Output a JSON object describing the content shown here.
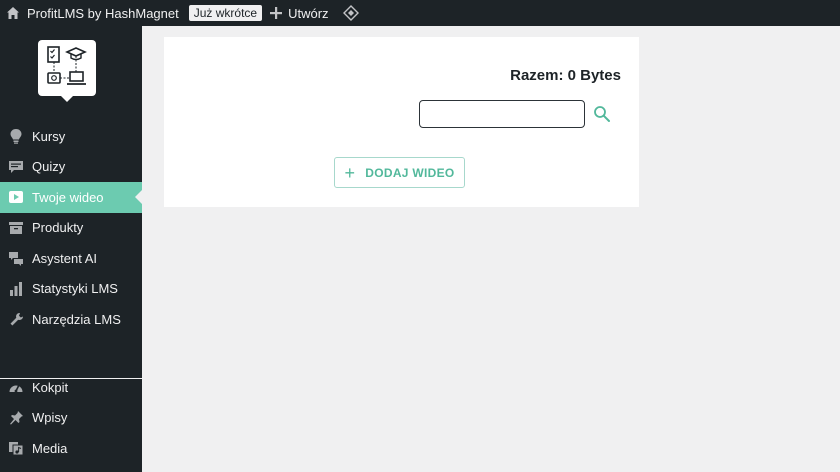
{
  "adminbar": {
    "site_name": "ProfitLMS by HashMagnet",
    "badge": "Już wkrótce",
    "new_label": "Utwórz"
  },
  "sidebar": {
    "items": [
      {
        "label": "Kursy",
        "icon": "lightbulb-icon"
      },
      {
        "label": "Quizy",
        "icon": "comment-icon"
      },
      {
        "label": "Twoje wideo",
        "icon": "video-play-icon",
        "active": true
      },
      {
        "label": "Produkty",
        "icon": "archive-box-icon"
      },
      {
        "label": "Asystent AI",
        "icon": "chat-bubbles-icon"
      },
      {
        "label": "Statystyki LMS",
        "icon": "bar-chart-icon"
      },
      {
        "label": "Narzędzia LMS",
        "icon": "wrench-icon"
      }
    ],
    "items2": [
      {
        "label": "Kokpit",
        "icon": "dashboard-icon"
      },
      {
        "label": "Wpisy",
        "icon": "pin-icon"
      },
      {
        "label": "Media",
        "icon": "media-icon"
      }
    ]
  },
  "content": {
    "total": "Razem: 0 Bytes",
    "search_value": "",
    "add_label": "DODAJ WIDEO"
  },
  "colors": {
    "accent": "#6ccbb0",
    "sidebar_bg": "#1d2327",
    "page_bg": "#f0f0f1"
  }
}
